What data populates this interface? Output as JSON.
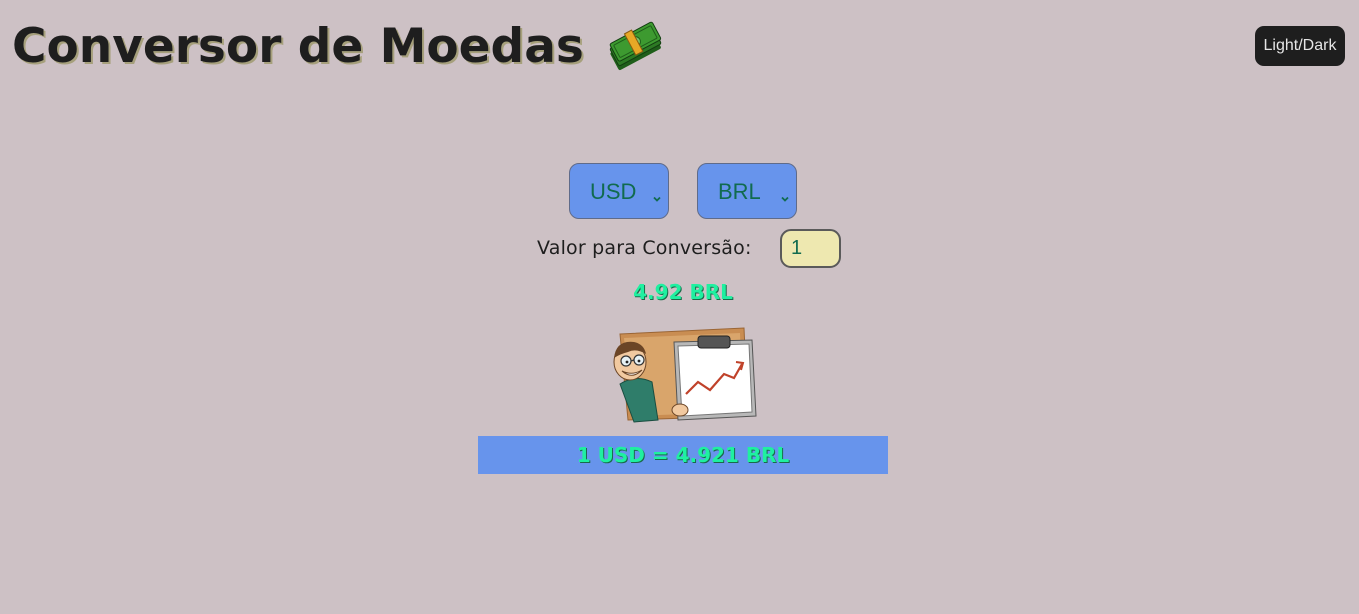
{
  "header": {
    "title": "Conversor de Moedas",
    "icon": "money-bills-icon"
  },
  "theme_toggle": {
    "label": "Light/Dark"
  },
  "converter": {
    "from_currency": "USD",
    "to_currency": "BRL",
    "value_label": "Valor para Conversão:",
    "value": "1",
    "result": "4.92 BRL",
    "illustration": "man-presenting-chart-illustration",
    "rate_text": "1 USD = 4.921 BRL"
  },
  "colors": {
    "background": "#cdc1c5",
    "accent": "#6794ec",
    "result_text": "#1ff0a0",
    "input_background": "#eee8b0",
    "toggle_background": "#1e1e1e"
  }
}
